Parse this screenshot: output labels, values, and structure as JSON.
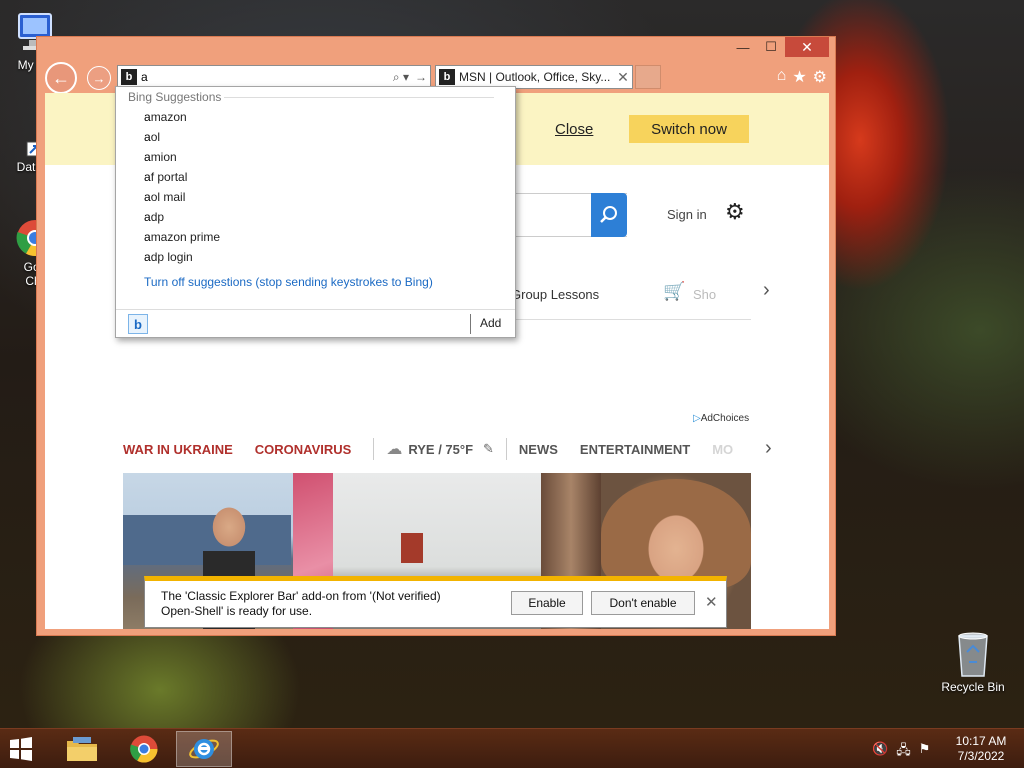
{
  "desktop": {
    "icons": [
      {
        "label": "My Co"
      },
      {
        "label": "DataW"
      },
      {
        "label": "Goo\nChr"
      },
      {
        "label": "Recycle Bin"
      }
    ]
  },
  "window": {
    "controls": {
      "minimize": "—",
      "maximize": "☐",
      "close": "✕"
    }
  },
  "address_bar": {
    "value": "a",
    "search_icon": "search-icon",
    "go_icon": "arrow-right-icon"
  },
  "tab": {
    "title": "MSN | Outlook, Office, Sky...",
    "close": "✕"
  },
  "suggestions": {
    "heading": "Bing Suggestions",
    "typed": "a",
    "items": [
      {
        "match": "a",
        "rest": "mazon"
      },
      {
        "match": "a",
        "rest": "ol"
      },
      {
        "match": "a",
        "rest": "mion"
      },
      {
        "match": "a",
        "rest": "f portal"
      },
      {
        "match": "a",
        "rest": "ol mail"
      },
      {
        "match": "a",
        "rest": "dp"
      },
      {
        "match": "a",
        "rest": "mazon prime"
      },
      {
        "match": "a",
        "rest": "dp login"
      }
    ],
    "turn_off_label": "Turn off suggestions (stop sending keystrokes to Bing)",
    "add_label": "Add"
  },
  "banner": {
    "close_label": "Close",
    "switch_label": "Switch now"
  },
  "msn": {
    "sign_in": "Sign in",
    "group_lessons": "Group Lessons",
    "shop_faded": "Sho",
    "adchoices": "AdChoices",
    "nav": {
      "war": "WAR IN UKRAINE",
      "corona": "CORONAVIRUS",
      "weather": "RYE / 75°F",
      "news": "NEWS",
      "entertainment": "ENTERTAINMENT",
      "more": "MO"
    }
  },
  "notification": {
    "message": "The 'Classic Explorer Bar' add-on from '(Not verified) Open-Shell' is ready for use.",
    "enable_label": "Enable",
    "dont_enable_label": "Don't enable"
  },
  "taskbar": {
    "time": "10:17 AM",
    "date": "7/3/2022"
  },
  "colors": {
    "window_frame": "#f0a07c",
    "accent_blue": "#2d7fd6",
    "banner_yellow": "#fbf4c3",
    "switch_button": "#f7d35c",
    "nav_red": "#b0302c",
    "notif_border": "#f2b300"
  }
}
